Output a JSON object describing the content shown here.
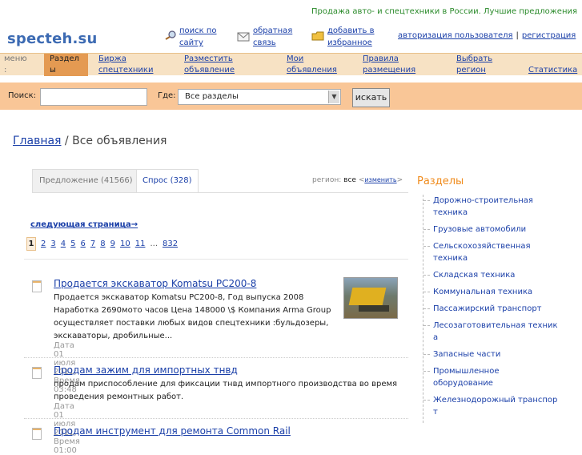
{
  "header": {
    "tagline": "Продажа авто- и спецтехники в России. Лучшие предложения",
    "logo": "specteh.su",
    "links": {
      "search_l1": "поиск по",
      "search_l2": "сайту",
      "feedback_l1": "обратная",
      "feedback_l2": "связь",
      "fav_l1": "добавить в",
      "fav_l2": "избранное"
    },
    "auth": "авторизация пользователя",
    "register": "регистрация"
  },
  "nav": {
    "menu_l1": "меню",
    "menu_l2": ":",
    "active_l1": "Раздел",
    "active_l2": "ы",
    "items": [
      {
        "l1": "Биржа",
        "l2": "спецтехники"
      },
      {
        "l1": "Разместить",
        "l2": "объявление"
      },
      {
        "l1": "Мои",
        "l2": "объявления"
      },
      {
        "l1": "Правила",
        "l2": "размещения"
      },
      {
        "l1": "Выбрать",
        "l2": "регион"
      },
      {
        "l1": "",
        "l2": "Статистика"
      }
    ]
  },
  "search": {
    "label": "Поиск:",
    "where_label": "Где:",
    "select_value": "Все разделы",
    "button": "искать"
  },
  "breadcrumb": {
    "home": "Главная",
    "sep": " / ",
    "current": "Все объявления"
  },
  "tabs": {
    "offer": "Предложение (41566)",
    "demand": "Спрос (328)"
  },
  "region": {
    "label": "регион:",
    "value": "все",
    "change": "изменить"
  },
  "pagination": {
    "next": "следующая страница→",
    "current": "1",
    "pages": [
      "2",
      "3",
      "4",
      "5",
      "6",
      "7",
      "8",
      "9",
      "10",
      "11"
    ],
    "dots": "...",
    "last": "832"
  },
  "listings": [
    {
      "title": "Продается экскаватор Komatsu PC200-8",
      "desc1": "Продается экскаватор   Komatsu   PC200-8,",
      "desc1b": "Год выпуска   2008",
      "desc2": "Наработка 2690мото часов Цена 148000 \\$   Компания Arma Group",
      "desc3": "осуществляет поставки любых видов спецтехники :бульдозеры,",
      "desc4": "экскаваторы, дробильные...",
      "date": "Дата 01 июля 2011; Время 03:48"
    },
    {
      "title": "Продам зажим для импортных тнвд",
      "desc1": "продам приспособление для фиксации тнвд импортного производства во время",
      "desc2": "проведения ремонтных работ.",
      "date": "Дата 01 июля 2011; Время 01:00"
    },
    {
      "title": "Продам инструмент для ремонта Common Rail"
    }
  ],
  "sidebar": {
    "title": "Разделы",
    "items": [
      {
        "l1": "Дорожно-строительная",
        "l2": "техника"
      },
      {
        "l1": "Грузовые автомобили",
        "l2": ""
      },
      {
        "l1": "Сельскохозяйственная",
        "l2": "техника"
      },
      {
        "l1": "Складская техника",
        "l2": ""
      },
      {
        "l1": "Коммунальная техника",
        "l2": ""
      },
      {
        "l1": "Пассажирский транспорт",
        "l2": ""
      },
      {
        "l1": "Лесозаготовительная техник",
        "l2": "а"
      },
      {
        "l1": "Запасные части",
        "l2": ""
      },
      {
        "l1": "Промышленное оборудование",
        "l2": ""
      },
      {
        "l1": "Железнодорожный транспор",
        "l2": "т"
      }
    ]
  },
  "colors": {
    "nav_bg": "#f7e2c4",
    "nav_active": "#e49a52",
    "search_bar": "#f9c697",
    "link": "#1a3fa8",
    "accent": "#f08c1e",
    "tagline": "#2a8a2a"
  }
}
